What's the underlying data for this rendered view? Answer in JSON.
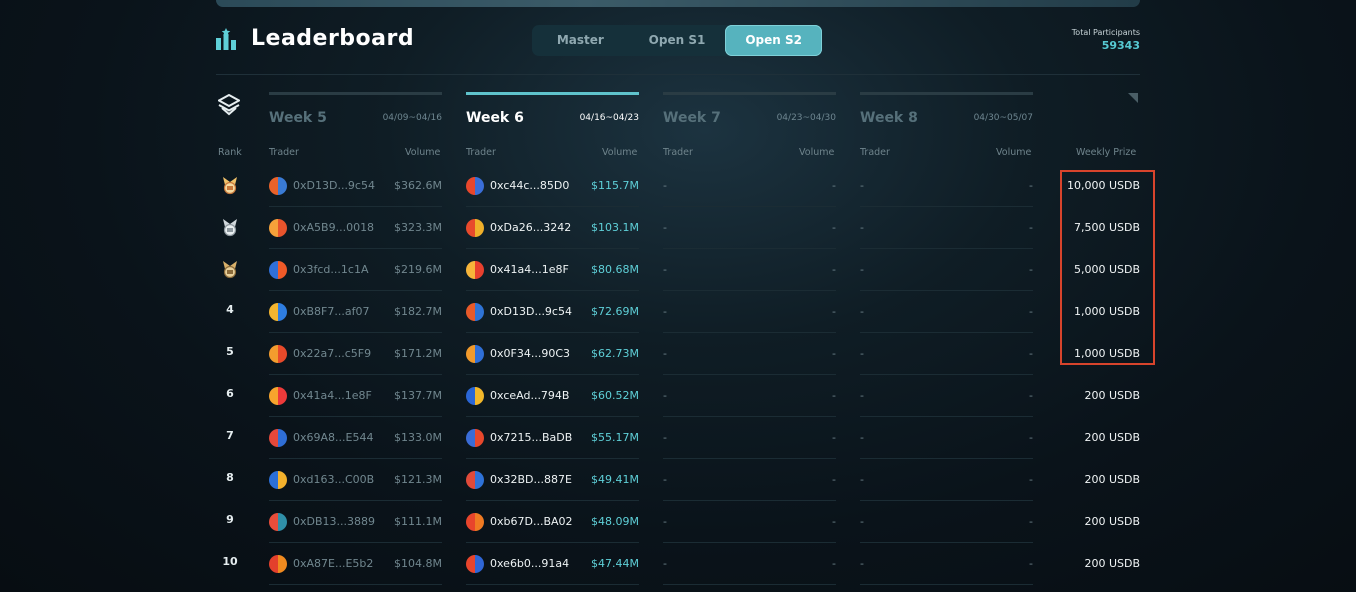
{
  "header": {
    "title": "Leaderboard",
    "tabs": [
      {
        "label": "Master",
        "active": false
      },
      {
        "label": "Open S1",
        "active": false
      },
      {
        "label": "Open S2",
        "active": true
      }
    ],
    "participants_label": "Total Participants",
    "participants_value": "59343"
  },
  "weeks": [
    {
      "name": "Week 5",
      "dates": "04/09~04/16",
      "active": false
    },
    {
      "name": "Week 6",
      "dates": "04/16~04/23",
      "active": true
    },
    {
      "name": "Week 7",
      "dates": "04/23~04/30",
      "active": false
    },
    {
      "name": "Week 8",
      "dates": "04/30~05/07",
      "active": false
    }
  ],
  "columns": {
    "rank": "Rank",
    "trader": "Trader",
    "volume": "Volume",
    "prize": "Weekly Prize"
  },
  "rows": [
    {
      "rank": "1",
      "medal": "gold",
      "w5_trader": "0xD13D...9c54",
      "w5_volume": "$362.6M",
      "w6_trader": "0xc44c...85D0",
      "w6_volume": "$115.7M",
      "w7_trader": "-",
      "w7_volume": "-",
      "w8_trader": "-",
      "w8_volume": "-",
      "prize": "10,000 USDB"
    },
    {
      "rank": "2",
      "medal": "silver",
      "w5_trader": "0xA5B9...0018",
      "w5_volume": "$323.3M",
      "w6_trader": "0xDa26...3242",
      "w6_volume": "$103.1M",
      "w7_trader": "-",
      "w7_volume": "-",
      "w8_trader": "-",
      "w8_volume": "-",
      "prize": "7,500 USDB"
    },
    {
      "rank": "3",
      "medal": "bronze",
      "w5_trader": "0x3fcd...1c1A",
      "w5_volume": "$219.6M",
      "w6_trader": "0x41a4...1e8F",
      "w6_volume": "$80.68M",
      "w7_trader": "-",
      "w7_volume": "-",
      "w8_trader": "-",
      "w8_volume": "-",
      "prize": "5,000 USDB"
    },
    {
      "rank": "4",
      "medal": "",
      "w5_trader": "0xB8F7...af07",
      "w5_volume": "$182.7M",
      "w6_trader": "0xD13D...9c54",
      "w6_volume": "$72.69M",
      "w7_trader": "-",
      "w7_volume": "-",
      "w8_trader": "-",
      "w8_volume": "-",
      "prize": "1,000 USDB"
    },
    {
      "rank": "5",
      "medal": "",
      "w5_trader": "0x22a7...c5F9",
      "w5_volume": "$171.2M",
      "w6_trader": "0x0F34...90C3",
      "w6_volume": "$62.73M",
      "w7_trader": "-",
      "w7_volume": "-",
      "w8_trader": "-",
      "w8_volume": "-",
      "prize": "1,000 USDB"
    },
    {
      "rank": "6",
      "medal": "",
      "w5_trader": "0x41a4...1e8F",
      "w5_volume": "$137.7M",
      "w6_trader": "0xceAd...794B",
      "w6_volume": "$60.52M",
      "w7_trader": "-",
      "w7_volume": "-",
      "w8_trader": "-",
      "w8_volume": "-",
      "prize": "200 USDB"
    },
    {
      "rank": "7",
      "medal": "",
      "w5_trader": "0x69A8...E544",
      "w5_volume": "$133.0M",
      "w6_trader": "0x7215...BaDB",
      "w6_volume": "$55.17M",
      "w7_trader": "-",
      "w7_volume": "-",
      "w8_trader": "-",
      "w8_volume": "-",
      "prize": "200 USDB"
    },
    {
      "rank": "8",
      "medal": "",
      "w5_trader": "0xd163...C00B",
      "w5_volume": "$121.3M",
      "w6_trader": "0x32BD...887E",
      "w6_volume": "$49.41M",
      "w7_trader": "-",
      "w7_volume": "-",
      "w8_trader": "-",
      "w8_volume": "-",
      "prize": "200 USDB"
    },
    {
      "rank": "9",
      "medal": "",
      "w5_trader": "0xDB13...3889",
      "w5_volume": "$111.1M",
      "w6_trader": "0xb67D...BA02",
      "w6_volume": "$48.09M",
      "w7_trader": "-",
      "w7_volume": "-",
      "w8_trader": "-",
      "w8_volume": "-",
      "prize": "200 USDB"
    },
    {
      "rank": "10",
      "medal": "",
      "w5_trader": "0xA87E...E5b2",
      "w5_volume": "$104.8M",
      "w6_trader": "0xe6b0...91a4",
      "w6_volume": "$47.44M",
      "w7_trader": "-",
      "w7_volume": "-",
      "w8_trader": "-",
      "w8_volume": "-",
      "prize": "200 USDB"
    }
  ],
  "avatars": {
    "w5": [
      [
        "#3a7bd5",
        "#e9622a"
      ],
      [
        "#e8542c",
        "#f6a23a"
      ],
      [
        "#f05a28",
        "#2f6fd8"
      ],
      [
        "#2e7de0",
        "#f4b52f"
      ],
      [
        "#e84a2a",
        "#f39c2e"
      ],
      [
        "#ee3a3a",
        "#f7a52d"
      ],
      [
        "#2f6ed6",
        "#e5483a"
      ],
      [
        "#f3b12c",
        "#2a6fd8"
      ],
      [
        "#2f8fa8",
        "#e84d3a"
      ],
      [
        "#f08a1f",
        "#e3402c"
      ]
    ],
    "w6": [
      [
        "#3a6ed8",
        "#e8472c"
      ],
      [
        "#f0b02a",
        "#e84a2c"
      ],
      [
        "#e8402e",
        "#f7b53a"
      ],
      [
        "#2e73d6",
        "#e85a2a"
      ],
      [
        "#2f6fd8",
        "#f19a2c"
      ],
      [
        "#f2b72a",
        "#2a66d6"
      ],
      [
        "#e8482c",
        "#3a6cd6"
      ],
      [
        "#2e72d8",
        "#e04a3a"
      ],
      [
        "#f07a22",
        "#e8452c"
      ],
      [
        "#2f66d6",
        "#e8452c"
      ]
    ]
  }
}
